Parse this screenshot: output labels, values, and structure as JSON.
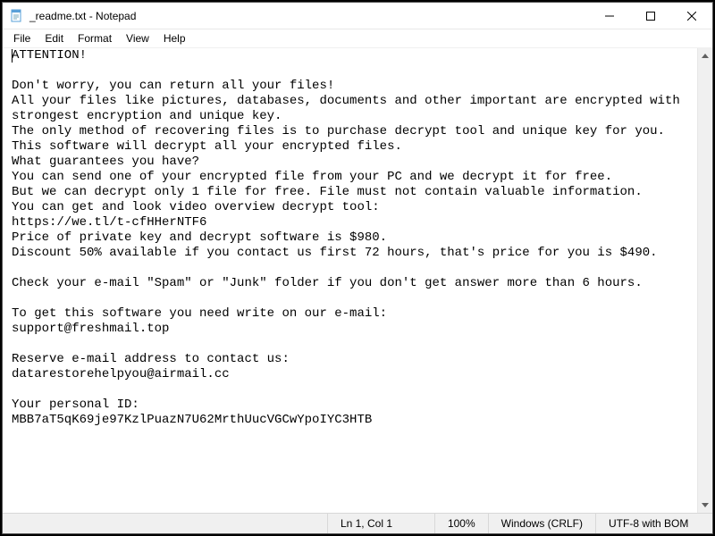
{
  "titlebar": {
    "title": "_readme.txt - Notepad"
  },
  "menubar": {
    "file": "File",
    "edit": "Edit",
    "format": "Format",
    "view": "View",
    "help": "Help"
  },
  "content": {
    "text": "ATTENTION!\n\nDon't worry, you can return all your files!\nAll your files like pictures, databases, documents and other important are encrypted with strongest encryption and unique key.\nThe only method of recovering files is to purchase decrypt tool and unique key for you.\nThis software will decrypt all your encrypted files.\nWhat guarantees you have?\nYou can send one of your encrypted file from your PC and we decrypt it for free.\nBut we can decrypt only 1 file for free. File must not contain valuable information.\nYou can get and look video overview decrypt tool:\nhttps://we.tl/t-cfHHerNTF6\nPrice of private key and decrypt software is $980.\nDiscount 50% available if you contact us first 72 hours, that's price for you is $490.\n\nCheck your e-mail \"Spam\" or \"Junk\" folder if you don't get answer more than 6 hours.\n\nTo get this software you need write on our e-mail:\nsupport@freshmail.top\n\nReserve e-mail address to contact us:\ndatarestorehelpyou@airmail.cc\n\nYour personal ID:\nMBB7aT5qK69je97KzlPuazN7U62MrthUucVGCwYpoIYC3HTB"
  },
  "statusbar": {
    "position": "Ln 1, Col 1",
    "zoom": "100%",
    "line_ending": "Windows (CRLF)",
    "encoding": "UTF-8 with BOM"
  }
}
